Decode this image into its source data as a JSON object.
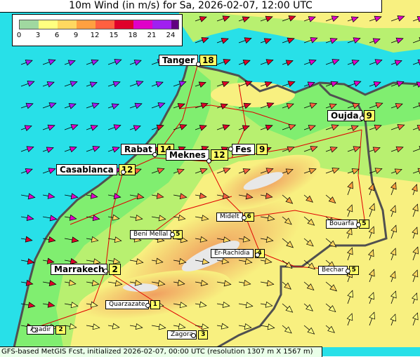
{
  "title": "10m Wind (in m/s) for Sa, 2026-02-07, 12:00 UTC",
  "footer": "GFS-based MetGIS Fcst, initialized 2026-02-07, 00:00 UTC  (resolution 1307 m X 1567 m)",
  "legend": {
    "ticks": [
      "0",
      "3",
      "6",
      "9",
      "12",
      "15",
      "18",
      "21",
      "24"
    ],
    "colors": [
      "#a0d8a0",
      "#ffff80",
      "#ffd860",
      "#ffa040",
      "#ff6040",
      "#e0002a",
      "#e000c8",
      "#a020f0",
      "#600080"
    ]
  },
  "palette": {
    "sea": "#28e0e8",
    "coast_plain": "#80ee70",
    "midland": "#b8f070",
    "highland": "#f8f080",
    "mountain": "#f0a060",
    "peak": "#e8e8e8",
    "roads": "#e00000",
    "border": "#505050"
  },
  "cities": [
    {
      "name": "Tanger",
      "value": "18",
      "style": "big"
    },
    {
      "name": "Oujda",
      "value": "9",
      "style": "big"
    },
    {
      "name": "Rabat",
      "value": "14",
      "style": "big"
    },
    {
      "name": "Meknes",
      "value": "12",
      "style": "big"
    },
    {
      "name": "Fes",
      "value": "9",
      "style": "big"
    },
    {
      "name": "Casablanca",
      "value": "12",
      "style": "big"
    },
    {
      "name": "Beni Mellal",
      "value": "5",
      "style": "small"
    },
    {
      "name": "Midelt",
      "value": "6",
      "style": "small"
    },
    {
      "name": "Bouarfa",
      "value": "5",
      "style": "small"
    },
    {
      "name": "Er-Rachidia",
      "value": "4",
      "style": "small"
    },
    {
      "name": "Marrakech",
      "value": "2",
      "style": "big"
    },
    {
      "name": "Bechar",
      "value": "5",
      "style": "small"
    },
    {
      "name": "Quarzazate",
      "value": "1",
      "style": "small"
    },
    {
      "name": "Agadir",
      "value": "2",
      "style": "small"
    },
    {
      "name": "Zagora",
      "value": "3",
      "style": "small"
    }
  ]
}
